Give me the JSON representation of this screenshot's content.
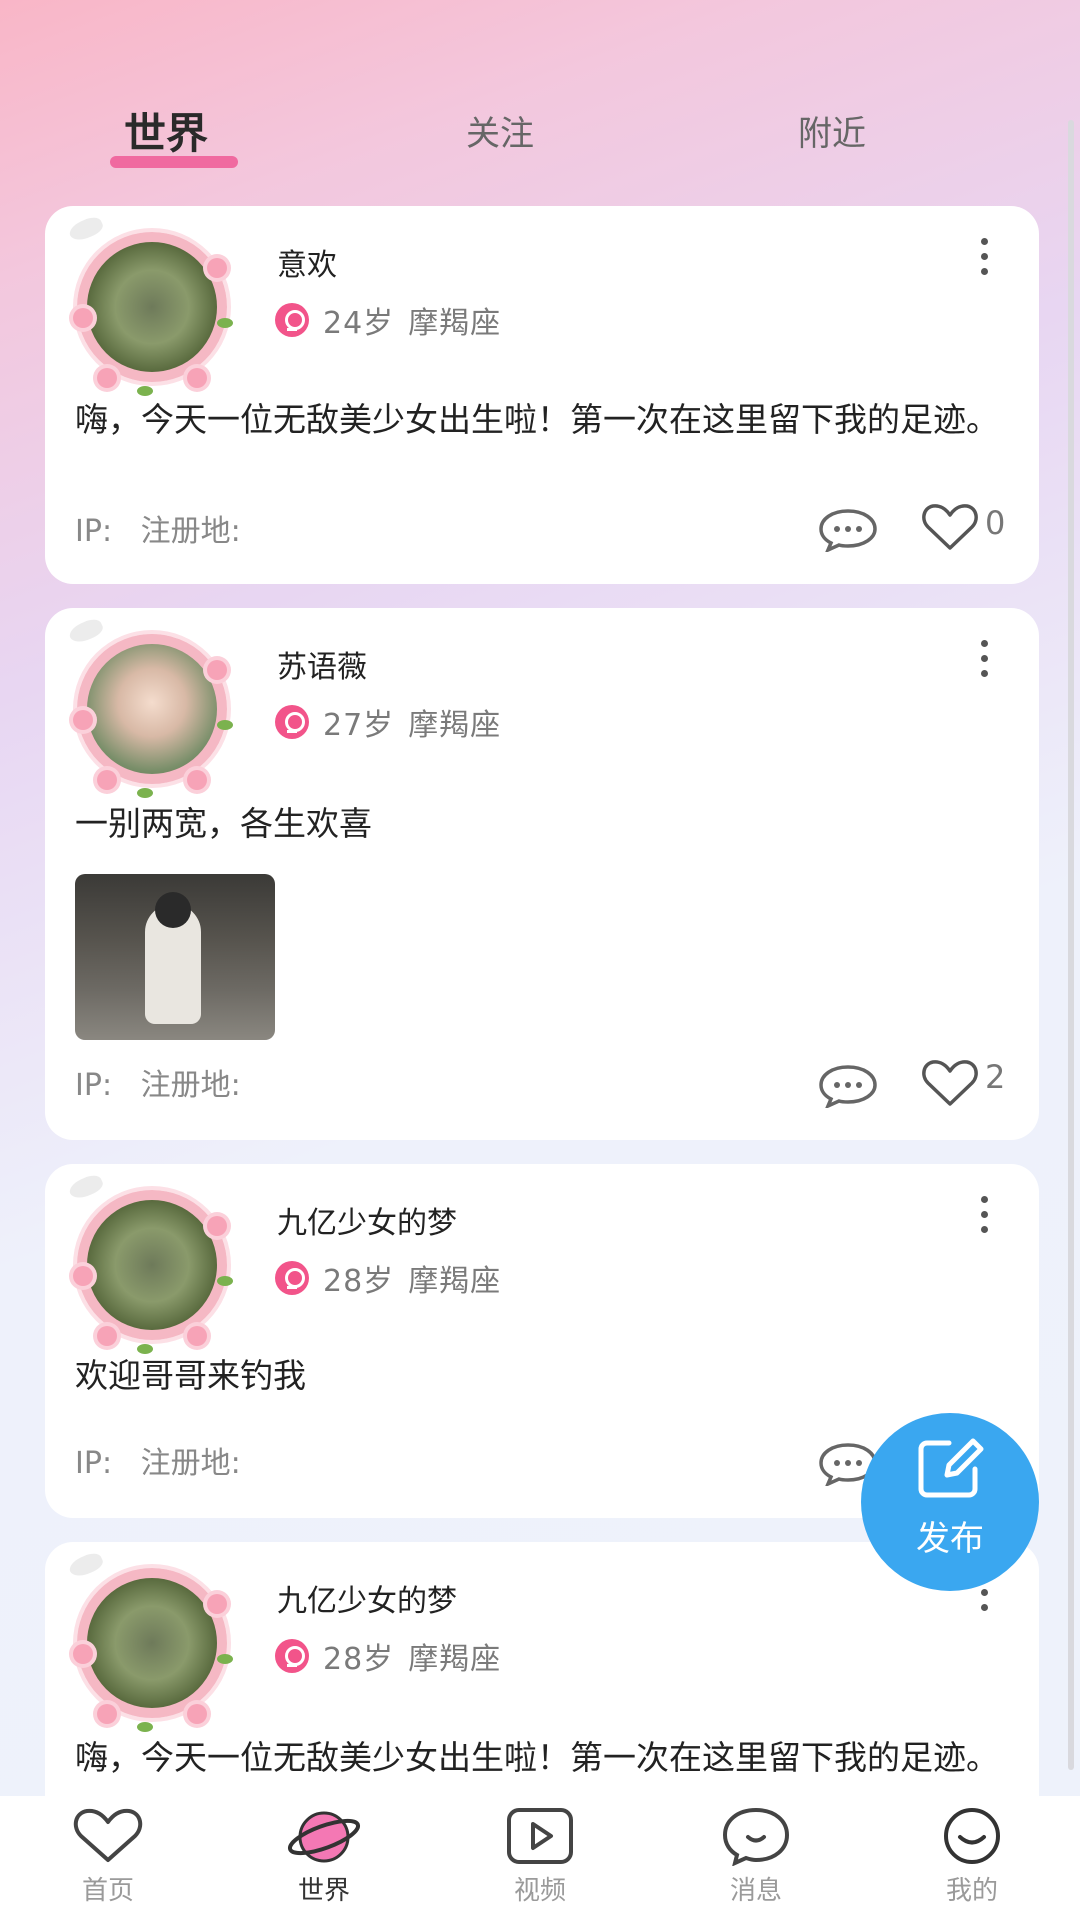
{
  "tabs": [
    {
      "label": "世界",
      "active": true
    },
    {
      "label": "关注",
      "active": false
    },
    {
      "label": "附近",
      "active": false
    }
  ],
  "posts": [
    {
      "name": "意欢",
      "age": "24岁",
      "constellation": "摩羯座",
      "content": "嗨，今天一位无敌美少女出生啦！第一次在这里留下我的足迹。",
      "ip_label": "IP:",
      "region_label": "注册地:",
      "likes": "0",
      "has_photo": false
    },
    {
      "name": "苏语薇",
      "age": "27岁",
      "constellation": "摩羯座",
      "content": "一别两宽，各生欢喜",
      "ip_label": "IP:",
      "region_label": "注册地:",
      "likes": "2",
      "has_photo": true
    },
    {
      "name": "九亿少女的梦",
      "age": "28岁",
      "constellation": "摩羯座",
      "content": "欢迎哥哥来钓我",
      "ip_label": "IP:",
      "region_label": "注册地:",
      "likes": "",
      "has_photo": false
    },
    {
      "name": "九亿少女的梦",
      "age": "28岁",
      "constellation": "摩羯座",
      "content": "嗨，今天一位无敌美少女出生啦！第一次在这里留下我的足迹。",
      "ip_label": "IP:",
      "region_label": "注册地:",
      "likes": "",
      "has_photo": false
    }
  ],
  "fab": {
    "label": "发布"
  },
  "bottom_nav": [
    {
      "label": "首页",
      "icon": "heart-icon",
      "active": false
    },
    {
      "label": "世界",
      "icon": "planet-icon",
      "active": true
    },
    {
      "label": "视频",
      "icon": "play-icon",
      "active": false
    },
    {
      "label": "消息",
      "icon": "chat-bubble-icon",
      "active": false
    },
    {
      "label": "我的",
      "icon": "smile-face-icon",
      "active": false
    }
  ],
  "colors": {
    "accent_pink": "#f06aa0",
    "gender_female": "#f2548a",
    "fab_blue": "#3aa7f0"
  }
}
